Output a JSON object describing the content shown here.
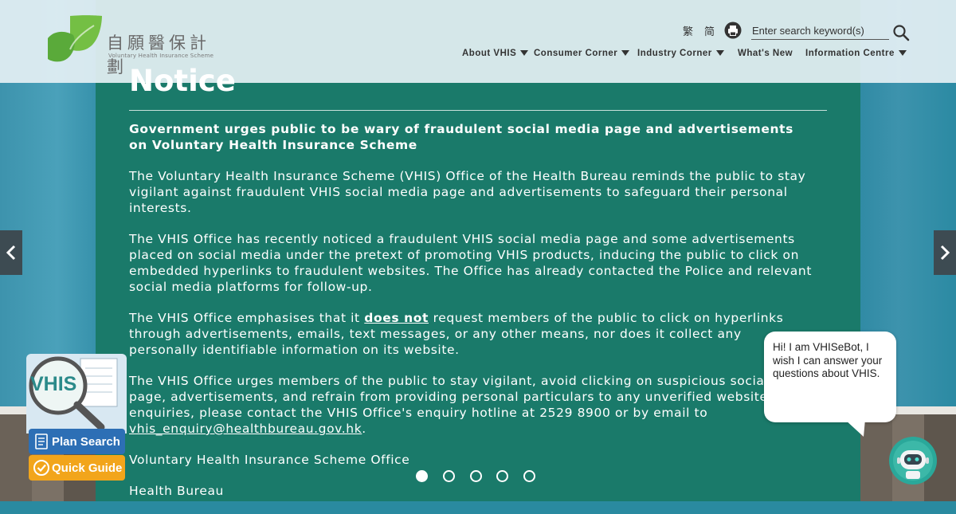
{
  "header": {
    "logo_cn": "自願醫保計劃",
    "logo_en": "Voluntary Health Insurance Scheme",
    "lang_tc": "繁",
    "lang_sc": "简",
    "search_placeholder": "Enter search keyword(s)",
    "nav": [
      {
        "label": "About VHIS",
        "has_dropdown": true
      },
      {
        "label": "Consumer Corner",
        "has_dropdown": true
      },
      {
        "label": "Industry Corner",
        "has_dropdown": true
      },
      {
        "label": "What's New",
        "has_dropdown": false
      },
      {
        "label": "Information Centre",
        "has_dropdown": true
      }
    ]
  },
  "notice": {
    "title": "Notice",
    "heading": "Government urges public to be wary of fraudulent social media page and advertisements on Voluntary Health Insurance Scheme",
    "p1": "The Voluntary Health Insurance Scheme (VHIS) Office of the Health Bureau reminds the public to stay vigilant against fraudulent VHIS social media page and advertisements to safeguard their personal interests.",
    "p2": "The VHIS Office has recently noticed a fraudulent VHIS social media page and some advertisements placed on social media under the pretext of promoting VHIS products, inducing the public to click on embedded hyperlinks to fraudulent websites. The Office has already contacted the Police and relevant social media platforms for follow-up.",
    "p3_a": "The VHIS Office emphasises that it ",
    "p3_emph": "does not",
    "p3_b": " request members of the public to click on hyperlinks through advertisements, emails, text messages, or any other means, nor does it collect any personally identifiable information on its website.",
    "p4": "The VHIS Office urges members of the public to stay vigilant, avoid clicking on suspicious social media page, advertisements, and refrain from providing personal particulars to any unverified websites. For enquiries, please contact the VHIS Office's enquiry hotline at 2529 8900 or by email to",
    "p4_email": "vhis_enquiry@healthbureau.gov.hk",
    "p4_end": ".",
    "sign_1": "Voluntary Health Insurance Scheme Office",
    "sign_2": "Health Bureau"
  },
  "carousel": {
    "slide_count": 5,
    "active_index": 0
  },
  "widget": {
    "badge": "VHIS",
    "plan_search": "Plan Search",
    "quick_guide": "Quick Guide"
  },
  "chatbot": {
    "message": "Hi! I am VHISeBot, I wish I can answer your questions about VHIS."
  },
  "colors": {
    "panel": "#1a7a6a",
    "header": "#e5f0f4",
    "plan_button": "#2d6fb5",
    "guide_button": "#f2a51b",
    "logo_green": "#5cb85c"
  }
}
